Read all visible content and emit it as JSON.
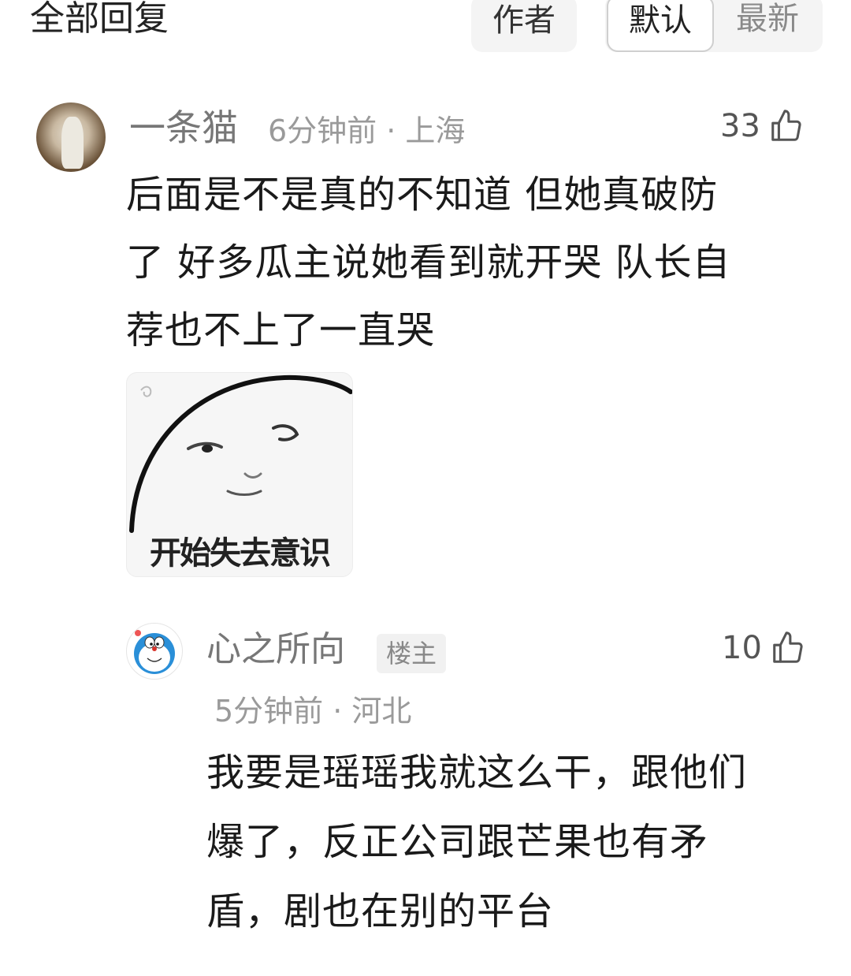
{
  "header": {
    "title": "全部回复",
    "tabs": {
      "author": "作者",
      "default": "默认",
      "latest": "最新"
    }
  },
  "comment": {
    "username": "一条猫",
    "meta": "6分钟前 · 上海",
    "likes": "33",
    "text_lines": [
      "后面是不是真的不知道 但她真破防",
      "了 好多瓜主说她看到就开哭 队长自",
      "荐也不上了一直哭"
    ],
    "sticker_caption": "开始失去意识"
  },
  "reply": {
    "username": "心之所向",
    "badge": "楼主",
    "meta": "5分钟前 · 河北",
    "likes": "10",
    "text_lines": [
      "我要是瑶瑶我就这么干，跟他们",
      "爆了，反正公司跟芒果也有矛",
      "盾，剧也在别的平台"
    ]
  },
  "colors": {
    "text_primary": "#1a1a1a",
    "text_secondary": "#777777",
    "text_meta": "#9a9a9a",
    "tab_bg": "#f4f4f4"
  }
}
